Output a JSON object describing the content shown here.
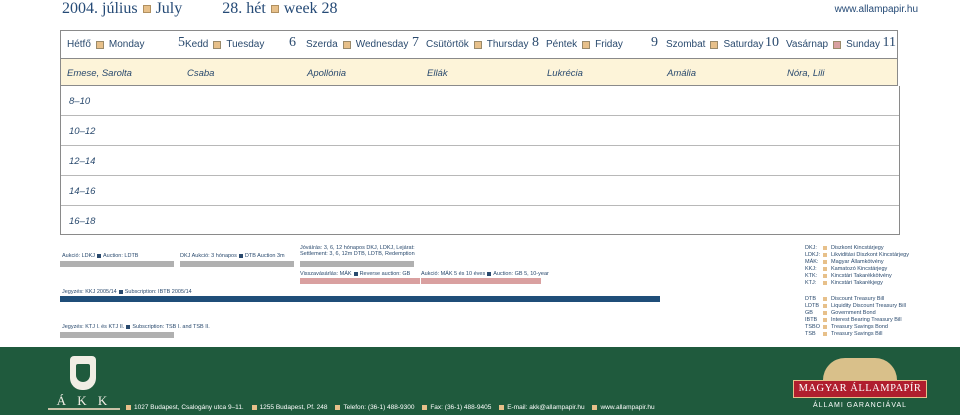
{
  "header": {
    "year": "2004.",
    "month_hu": "július",
    "month_en": "July",
    "week_hu": "28. hét",
    "week_en": "week 28",
    "url": "www.allampapir.hu"
  },
  "days": [
    {
      "hu": "Hétfő",
      "en": "Monday",
      "num": "5",
      "color": "#e7c08a"
    },
    {
      "hu": "Kedd",
      "en": "Tuesday",
      "num": "6",
      "color": "#e7c08a"
    },
    {
      "hu": "Szerda",
      "en": "Wednesday",
      "num": "7",
      "color": "#e7c08a"
    },
    {
      "hu": "Csütörtök",
      "en": "Thursday",
      "num": "8",
      "color": "#e7c08a"
    },
    {
      "hu": "Péntek",
      "en": "Friday",
      "num": "9",
      "color": "#e7c08a"
    },
    {
      "hu": "Szombat",
      "en": "Saturday",
      "num": "10",
      "color": "#e7c08a"
    },
    {
      "hu": "Vasárnap",
      "en": "Sunday",
      "num": "11",
      "color": "#d9a0a0"
    }
  ],
  "namedays": [
    "Emese, Sarolta",
    "Csaba",
    "Apollónia",
    "Ellák",
    "Lukrécia",
    "Amália",
    "Nóra, Lili"
  ],
  "time_slots": [
    "8–10",
    "10–12",
    "12–14",
    "14–16",
    "16–18"
  ],
  "events": {
    "mon_auction": "Aukció: LDKJ",
    "mon_auction_en": "Auction: LDTB",
    "tue_auction": "DKJ Aukció: 3 hónapos",
    "tue_auction_en": "DTB Auction 3m",
    "wed_settle1": "Jóváírás: 3, 6, 12 hónapos DKJ, LDKJ, Lejárat:",
    "wed_settle2": "Settlement: 3, 6, 12m DTB, LDTB, Redemption",
    "wed_rev": "Visszavásárlás: MÁK",
    "wed_rev_en": "Reverse auction: GB",
    "thu_auction": "Aukció: MÁK 5 és 10 éves",
    "thu_auction_en": "Auction: GB 5, 10-year",
    "sub1": "Jegyzés: KKJ 2005/14",
    "sub1_en": "Subscription: IBTB 2005/14",
    "sub2": "Jegyzés: KTJ I. és KTJ II.",
    "sub2_en": "Subscription: TSB I. and TSB II."
  },
  "legend": [
    {
      "abbr": "DKJ:",
      "label": "Diszkont Kincstárjegy",
      "color": "#e7c08a"
    },
    {
      "abbr": "LDKJ:",
      "label": "Likviditási Diszkont Kincstárjegy",
      "color": "#e7c08a"
    },
    {
      "abbr": "MÁK:",
      "label": "Magyar Államkötvény",
      "color": "#e7c08a"
    },
    {
      "abbr": "KKJ:",
      "label": "Kamatozó Kincstárjegy",
      "color": "#e7c08a"
    },
    {
      "abbr": "KTK:",
      "label": "Kincstári Takarékkötvény",
      "color": "#e7c08a"
    },
    {
      "abbr": "KTJ:",
      "label": "Kincstári Takarékjegy",
      "color": "#e7c08a"
    },
    {
      "abbr": "DTB",
      "label": "Discount Treasury Bill",
      "color": "#e7c08a"
    },
    {
      "abbr": "LDTB",
      "label": "Liquidity Discount Treasury Bill",
      "color": "#e7c08a"
    },
    {
      "abbr": "GB",
      "label": "Government Bond",
      "color": "#e7c08a"
    },
    {
      "abbr": "IBTB",
      "label": "Interest Bearing Treasury Bill",
      "color": "#e7c08a"
    },
    {
      "abbr": "TSBO",
      "label": "Treasury Savings Bond",
      "color": "#e7c08a"
    },
    {
      "abbr": "TSB",
      "label": "Treasury Savings Bill",
      "color": "#e7c08a"
    }
  ],
  "colors": {
    "bar_gray": "#b0b0b0",
    "bar_pink": "#d9a0a0",
    "bar_blue": "#1f4e79",
    "footer_green": "#1f5a3d"
  },
  "footer": {
    "akk_abbr": "Á K K",
    "address1": "1027 Budapest, Csalogány utca 9–11.",
    "address2": "1255 Budapest, Pf. 248",
    "phone": "Telefon: (36-1) 488-9300",
    "fax": "Fax: (36-1) 488-9405",
    "email": "E-mail: akk@allampapir.hu",
    "web": "www.allampapir.hu",
    "brand": "MAGYAR ÁLLAMPAPÍR",
    "tagline": "ÁLLAMI GARANCIÁVAL"
  }
}
